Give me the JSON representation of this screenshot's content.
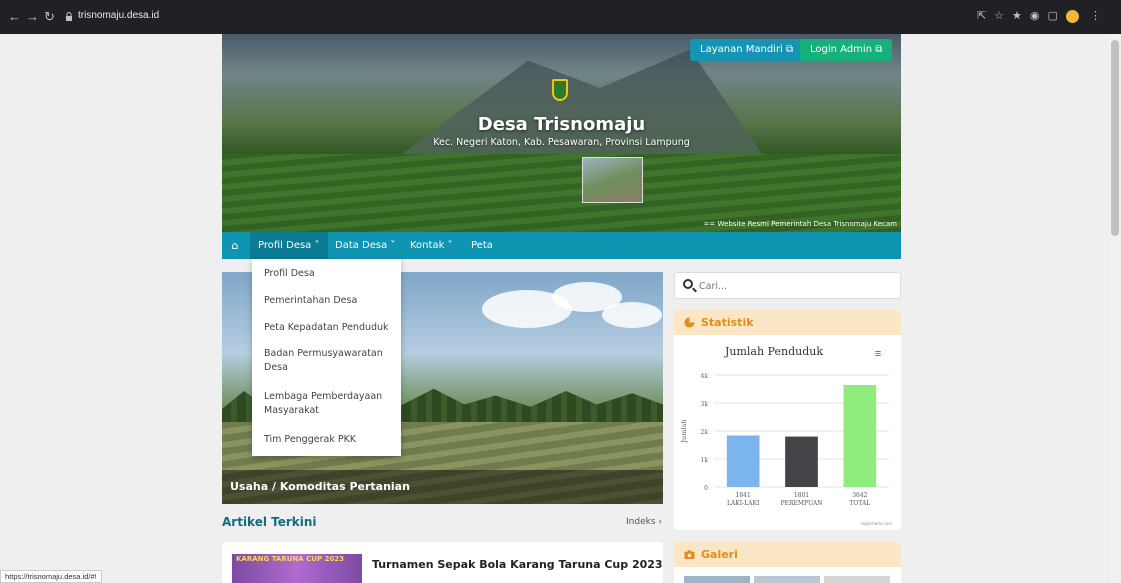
{
  "browser": {
    "url": "trisnomaju.desa.id",
    "status_url": "https://trisnomaju.desa.id/#!"
  },
  "header": {
    "btn_layanan": "Layanan Mandiri",
    "btn_login": "Login Admin",
    "title": "Desa Trisnomaju",
    "subtitle": "Kec. Negeri Katon, Kab. Pesawaran, Provinsi Lampung",
    "marquee": "== Website Resmi Pemerintah Desa Trisnomaju Kecam"
  },
  "nav": {
    "items": [
      "Profil Desa",
      "Data Desa",
      "Kontak",
      "Peta"
    ]
  },
  "dropdown": {
    "items": [
      "Profil Desa",
      "Pemerintahan Desa",
      "Peta Kepadatan Penduduk",
      "Badan Permusyawaratan Desa",
      "Lembaga Pemberdayaan Masyarakat",
      "Tim Penggerak PKK"
    ]
  },
  "slider": {
    "caption": "Usaha / Komoditas Pertanian"
  },
  "artikel": {
    "heading": "Artikel Terkini",
    "indeks": "Indeks",
    "first_title": "Turnamen Sepak Bola Karang Taruna Cup 2023",
    "first_image_text": "KARANG TARUNA CUP 2023"
  },
  "sidebar": {
    "search_placeholder": "Cari...",
    "statistik_label": "Statistik",
    "galeri_label": "Galeri"
  },
  "colors": {
    "nav": "#0f94b1",
    "login": "#16b07a",
    "panel_head": "#fbe7c6",
    "panel_text": "#e08e1c"
  },
  "chart_data": {
    "type": "bar",
    "title": "Jumlah Penduduk",
    "ylabel": "Jumlah",
    "categories": [
      "LAKI-LAKI",
      "PEREMPUAN",
      "TOTAL"
    ],
    "values": [
      1841,
      1801,
      3642
    ],
    "colors": [
      "#7cb5ec",
      "#434348",
      "#90ed7d"
    ],
    "yticks": [
      "0",
      "1k",
      "2k",
      "3k",
      "4k"
    ],
    "ylim": [
      0,
      4000
    ],
    "credit": "Highcharts.com"
  }
}
